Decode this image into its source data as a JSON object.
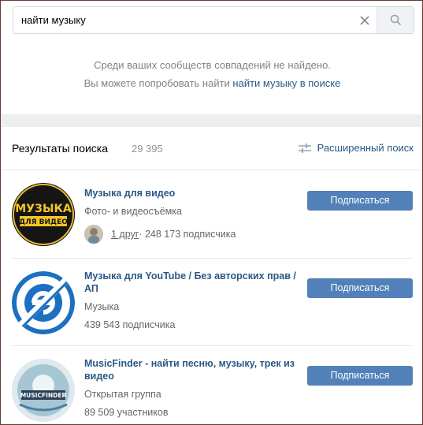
{
  "search": {
    "value": "найти музыку",
    "placeholder": ""
  },
  "empty_state": {
    "line1": "Среди ваших сообществ совпадений не найдено.",
    "line2_prefix": "Вы можете попробовать найти ",
    "line2_link": "найти музыку в поиске"
  },
  "results": {
    "title": "Результаты поиска",
    "count": "29 395",
    "advanced_search_label": "Расширенный поиск",
    "items": [
      {
        "name": "Музыка для видео",
        "category": "Фото- и видеосъёмка",
        "friends_link": "1 друг",
        "members": " · 248 173 подписчика",
        "button": "Подписаться",
        "avatar_text": [
          "МУЗЫКА",
          "ДЛЯ ВИДЕО"
        ]
      },
      {
        "name": "Музыка для YouTube / Без авторских прав / АП",
        "category": "Музыка",
        "members": "439 543 подписчика",
        "button": "Подписаться"
      },
      {
        "name": "MusicFinder - найти песню, музыку, трек из видео",
        "category": "Открытая группа",
        "members": "89 509 участников",
        "button": "Подписаться",
        "avatar_text": "MUSICFINDER"
      }
    ]
  },
  "colors": {
    "accent_button": "#5181b8",
    "link": "#2a5885",
    "page_bg": "#edeef0"
  }
}
